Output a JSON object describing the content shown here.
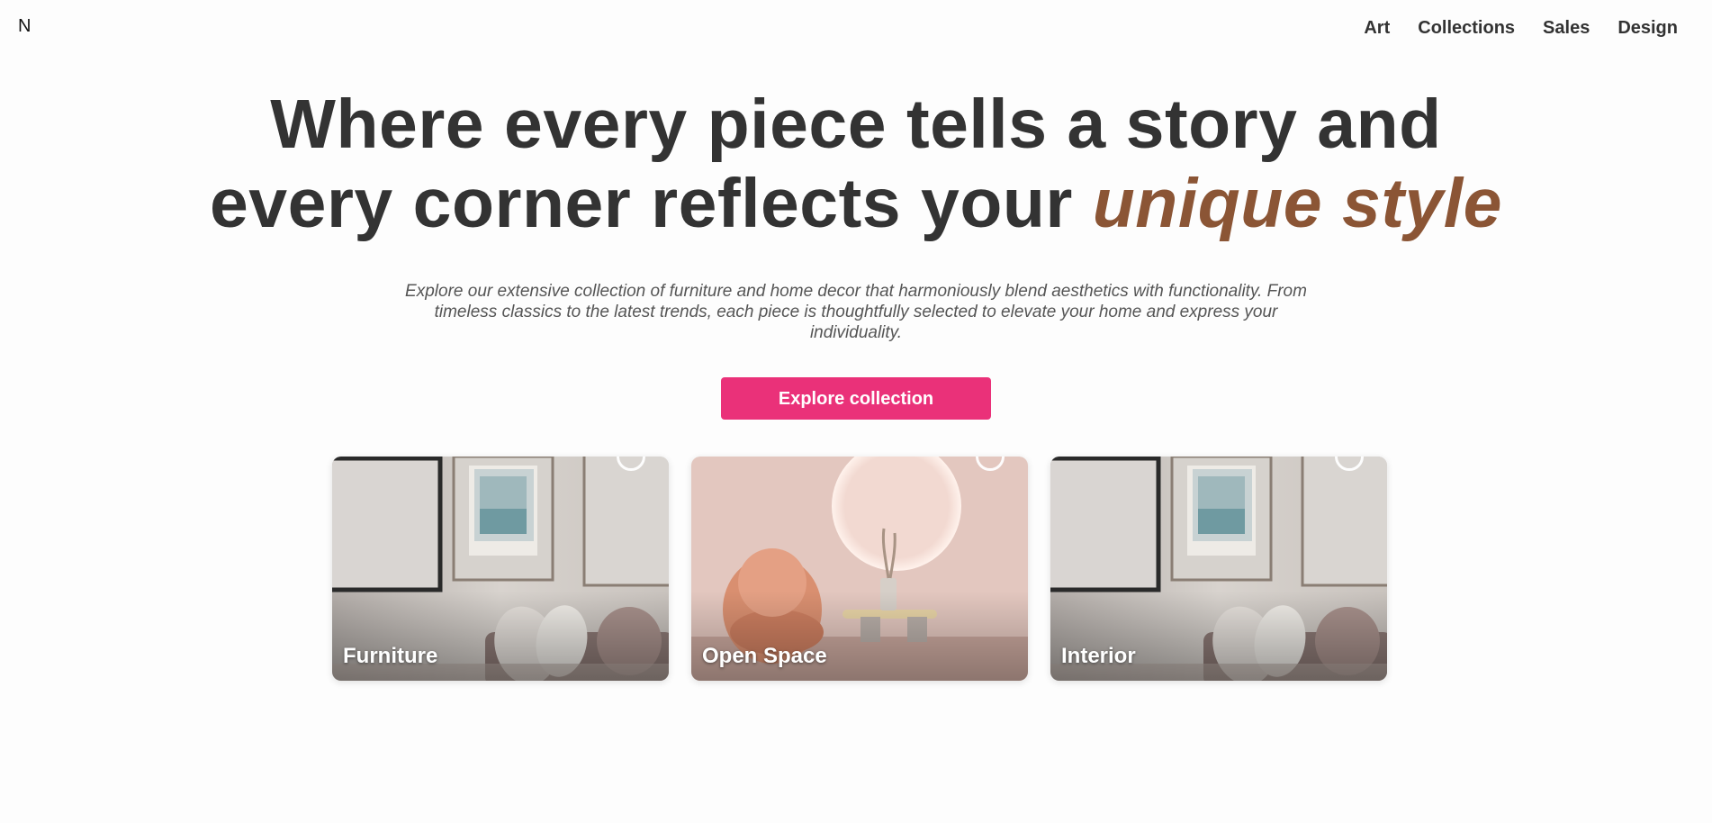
{
  "brand": {
    "logo": "N"
  },
  "nav": {
    "items": [
      "Art",
      "Collections",
      "Sales",
      "Design"
    ]
  },
  "hero": {
    "headline_line1": "Where every piece tells a story and",
    "headline_line2_plain": "every corner reflects your ",
    "headline_accent": "unique style",
    "subtext": "Explore our extensive collection of furniture and home decor that harmoniously blend aesthetics with functionality. From timeless classics to the latest trends, each piece is thoughtfully selected to elevate your home and express your individuality.",
    "cta_label": "Explore collection"
  },
  "cards": [
    {
      "label": "Furniture"
    },
    {
      "label": "Open Space"
    },
    {
      "label": "Interior"
    }
  ],
  "colors": {
    "accent": "#8b5535",
    "cta": "#ea3179",
    "text": "#333333"
  }
}
